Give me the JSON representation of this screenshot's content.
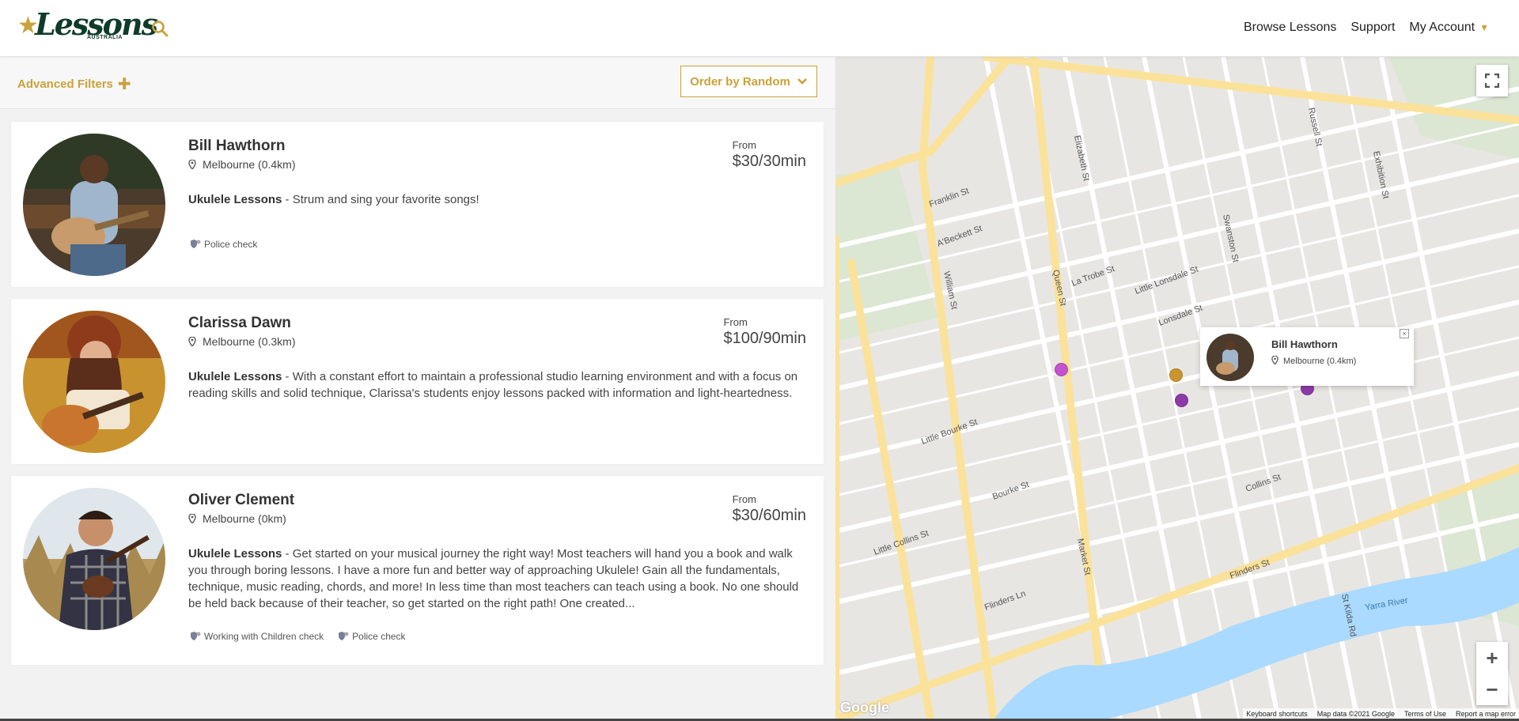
{
  "header": {
    "logo_text": "Lessons",
    "logo_sub": "AUSTRALIA",
    "nav": [
      "Browse Lessons",
      "Support",
      "My Account"
    ]
  },
  "filters": {
    "advanced_label": "Advanced Filters",
    "order_label": "Order by Random"
  },
  "teachers": [
    {
      "name": "Bill Hawthorn",
      "location": "Melbourne (0.4km)",
      "price_from": "From",
      "price": "$30/30min",
      "lesson_type": "Ukulele Lessons",
      "description": " - Strum and sing your favorite songs!",
      "badges": [
        "Police check"
      ]
    },
    {
      "name": "Clarissa Dawn",
      "location": "Melbourne (0.3km)",
      "price_from": "From",
      "price": "$100/90min",
      "lesson_type": "Ukulele Lessons",
      "description": " - With a constant effort to maintain a professional studio learning environment and with a focus on reading skills and solid technique, Clarissa's students enjoy lessons packed with information and light-heartedness.",
      "badges": []
    },
    {
      "name": "Oliver Clement",
      "location": "Melbourne (0km)",
      "price_from": "From",
      "price": "$30/60min",
      "lesson_type": "Ukulele Lessons",
      "description": " - Get started on your musical journey the right way! Most teachers will hand you a book and walk you through boring lessons. I have a more fun and better way of approaching Ukulele! Gain all the fundamentals, technique, music reading, chords, and more! In less time than most teachers can teach using a book. No one should be held back because of their teacher, so get started on the right path! One created...",
      "badges": [
        "Working with Children check",
        "Police check"
      ]
    }
  ],
  "map": {
    "popup_name": "Bill Hawthorn",
    "popup_location": "Melbourne (0.4km)",
    "popup_close": "×",
    "zoom_in": "+",
    "zoom_out": "−",
    "google": "Google",
    "attribution": [
      "Keyboard shortcuts",
      "Map data ©2021 Google",
      "Terms of Use",
      "Report a map error"
    ],
    "street_labels": [
      "Elizabeth St",
      "William St",
      "La Trobe St",
      "Lonsdale St",
      "Little Lonsdale St",
      "Collins St",
      "Flinders St",
      "Exhibition St",
      "Russell St",
      "Yarra River",
      "Bourke St",
      "Little Bourke St",
      "Little Collins St",
      "Flinders Ln",
      "Queen St",
      "Market St",
      "St Kilda Rd",
      "Swanston St",
      "Franklin St",
      "A'Beckett St"
    ],
    "colors": {
      "marker_purple": "#8e3ba8",
      "marker_pink": "#c452d1",
      "marker_gold": "#c9952d"
    }
  }
}
